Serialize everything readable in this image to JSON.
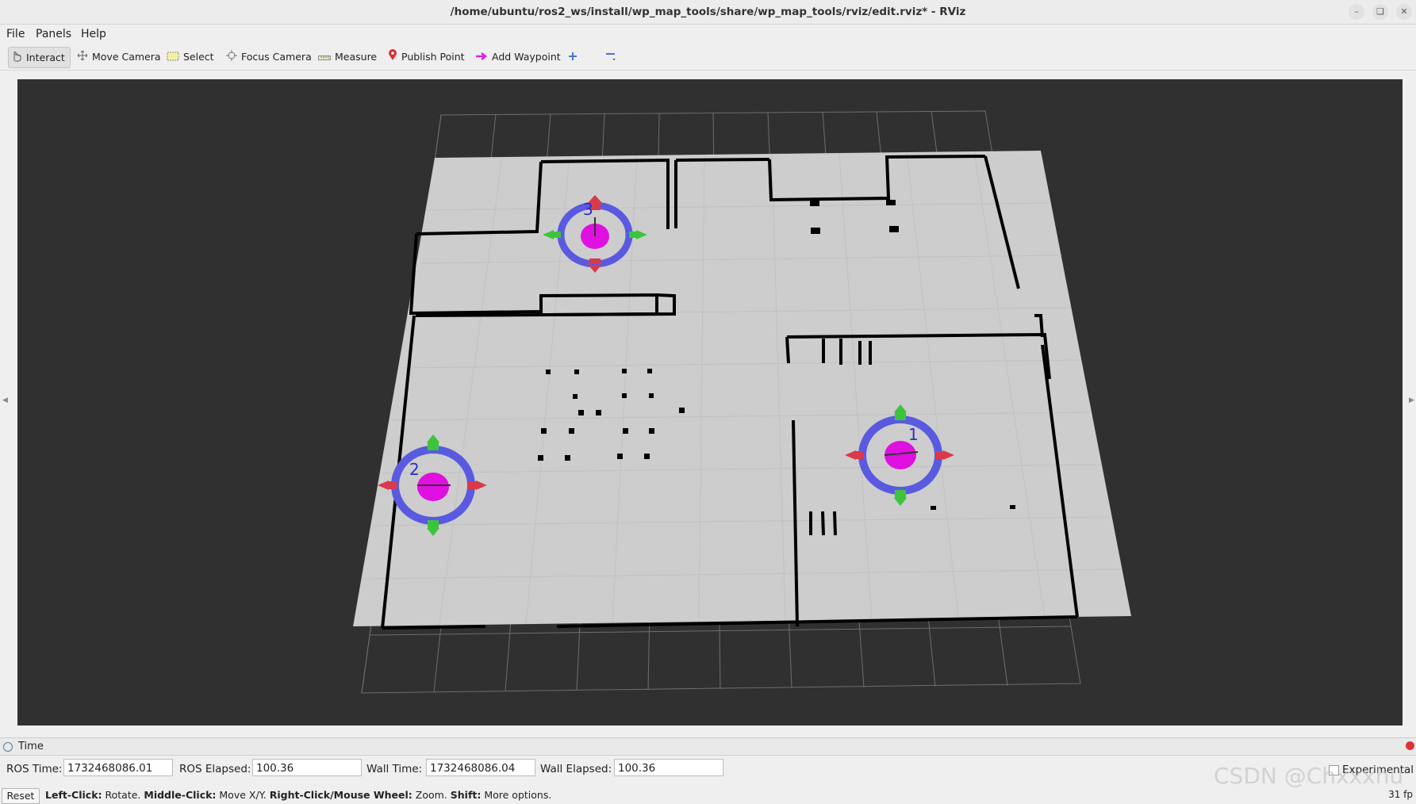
{
  "window": {
    "title": "/home/ubuntu/ros2_ws/install/wp_map_tools/share/wp_map_tools/rviz/edit.rviz* - RViz"
  },
  "menu": [
    "File",
    "Panels",
    "Help"
  ],
  "toolbar": {
    "interact": "Interact",
    "move_camera": "Move Camera",
    "select": "Select",
    "focus_camera": "Focus Camera",
    "measure": "Measure",
    "publish_point": "Publish Point",
    "add_waypoint": "Add Waypoint"
  },
  "viewport": {
    "waypoints": [
      {
        "label": "1"
      },
      {
        "label": "2"
      },
      {
        "label": "3"
      }
    ]
  },
  "time_panel": {
    "title": "Time",
    "ros_time_label": "ROS Time:",
    "ros_time": "1732468086.01",
    "ros_elapsed_label": "ROS Elapsed:",
    "ros_elapsed": "100.36",
    "wall_time_label": "Wall Time:",
    "wall_time": "1732468086.04",
    "wall_elapsed_label": "Wall Elapsed:",
    "wall_elapsed": "100.36",
    "experimental": "Experimental"
  },
  "status": {
    "reset": "Reset",
    "lc": "Left-Click:",
    "lc_text": " Rotate. ",
    "mc": "Middle-Click:",
    "mc_text": " Move X/Y. ",
    "rc": "Right-Click/Mouse Wheel:",
    "rc_text": " Zoom. ",
    "sh": "Shift:",
    "sh_text": " More options.",
    "fps": "31 fp"
  },
  "watermark": "CSDN @Chxxxhu",
  "colors": {
    "viewport_bg": "#303030",
    "map_floor": "#cdcdcd",
    "wall": "#000000",
    "waypoint_ring": "#5a5ae0",
    "waypoint_core": "#e010e0",
    "arrow_red": "#d83a4a",
    "arrow_green": "#3cc43c"
  }
}
